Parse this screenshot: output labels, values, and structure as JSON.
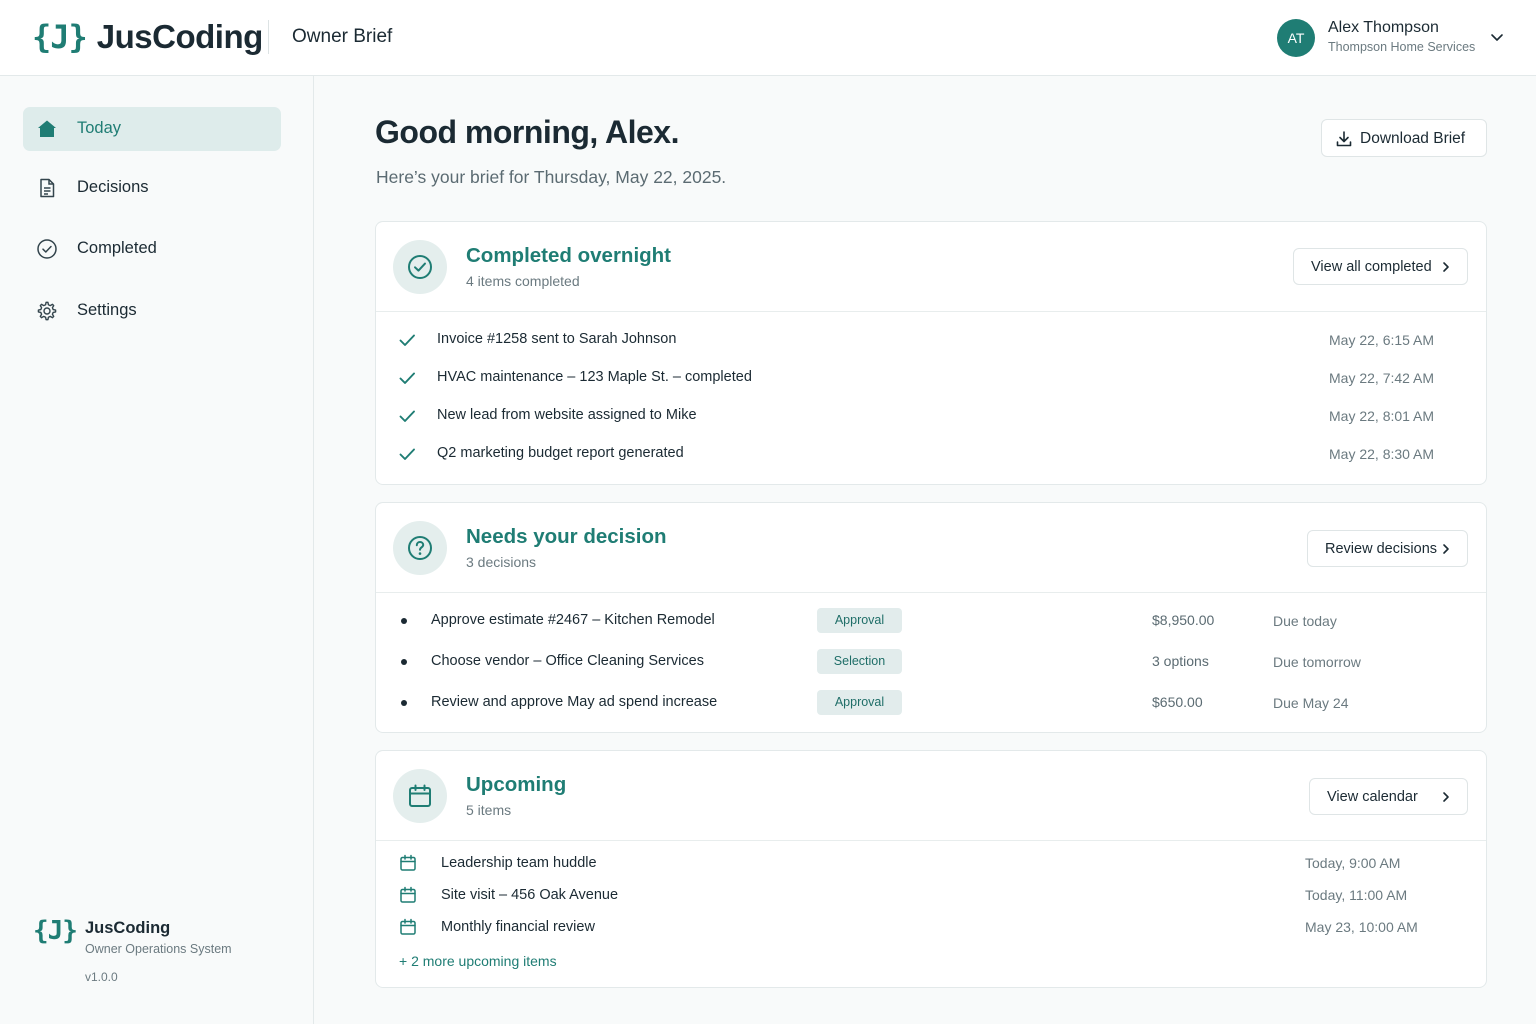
{
  "header": {
    "logo_mark": "{J}",
    "logo_text": "JusCoding",
    "title": "Owner Brief",
    "user": {
      "initials": "AT",
      "name": "Alex Thompson",
      "company": "Thompson Home Services"
    }
  },
  "sidebar": {
    "items": [
      {
        "label": "Today",
        "icon": "home-icon",
        "active": true
      },
      {
        "label": "Decisions",
        "icon": "document-icon",
        "active": false
      },
      {
        "label": "Completed",
        "icon": "check-circle-icon",
        "active": false
      },
      {
        "label": "Settings",
        "icon": "gear-icon",
        "active": false
      }
    ],
    "footer": {
      "logo_mark": "{J}",
      "name": "JusCoding",
      "subtitle": "Owner Operations System",
      "version": "v1.0.0"
    }
  },
  "main": {
    "greeting": "Good morning, Alex.",
    "subtitle": "Here’s your brief for Thursday, May 22, 2025.",
    "download_label": "Download Brief",
    "completed": {
      "title": "Completed overnight",
      "subtitle": "4 items completed",
      "button": "View all completed",
      "items": [
        {
          "text": "Invoice #1258 sent to Sarah Johnson",
          "time": "May 22, 6:15 AM"
        },
        {
          "text": "HVAC maintenance – 123 Maple St.  – completed",
          "time": "May 22, 7:42 AM"
        },
        {
          "text": "New lead from website assigned to Mike",
          "time": "May 22, 8:01 AM"
        },
        {
          "text": "Q2 marketing budget report generated",
          "time": "May 22, 8:30 AM"
        }
      ]
    },
    "decisions": {
      "title": "Needs your decision",
      "subtitle": "3 decisions",
      "button": "Review decisions",
      "items": [
        {
          "text": "Approve estimate #2467 – Kitchen Remodel",
          "tag": "Approval",
          "amount": "$8,950.00",
          "due": "Due today"
        },
        {
          "text": "Choose vendor – Office Cleaning Services",
          "tag": "Selection",
          "amount": "3 options",
          "due": "Due tomorrow"
        },
        {
          "text": "Review and approve May ad spend increase",
          "tag": "Approval",
          "amount": "$650.00",
          "due": "Due May 24"
        }
      ]
    },
    "upcoming": {
      "title": "Upcoming",
      "subtitle": "5 items",
      "button": "View calendar",
      "items": [
        {
          "text": "Leadership team huddle",
          "time": "Today, 9:00 AM"
        },
        {
          "text": "Site visit – 456 Oak Avenue",
          "time": "Today, 11:00 AM"
        },
        {
          "text": "Monthly financial review",
          "time": "May 23, 10:00 AM"
        }
      ],
      "more": "+ 2 more upcoming items"
    }
  },
  "colors": {
    "accent": "#1f7d74",
    "active_bg": "#deeceb",
    "tag_bg": "#e2ecec",
    "text": "#1b2a33",
    "muted": "#6b7a80"
  }
}
